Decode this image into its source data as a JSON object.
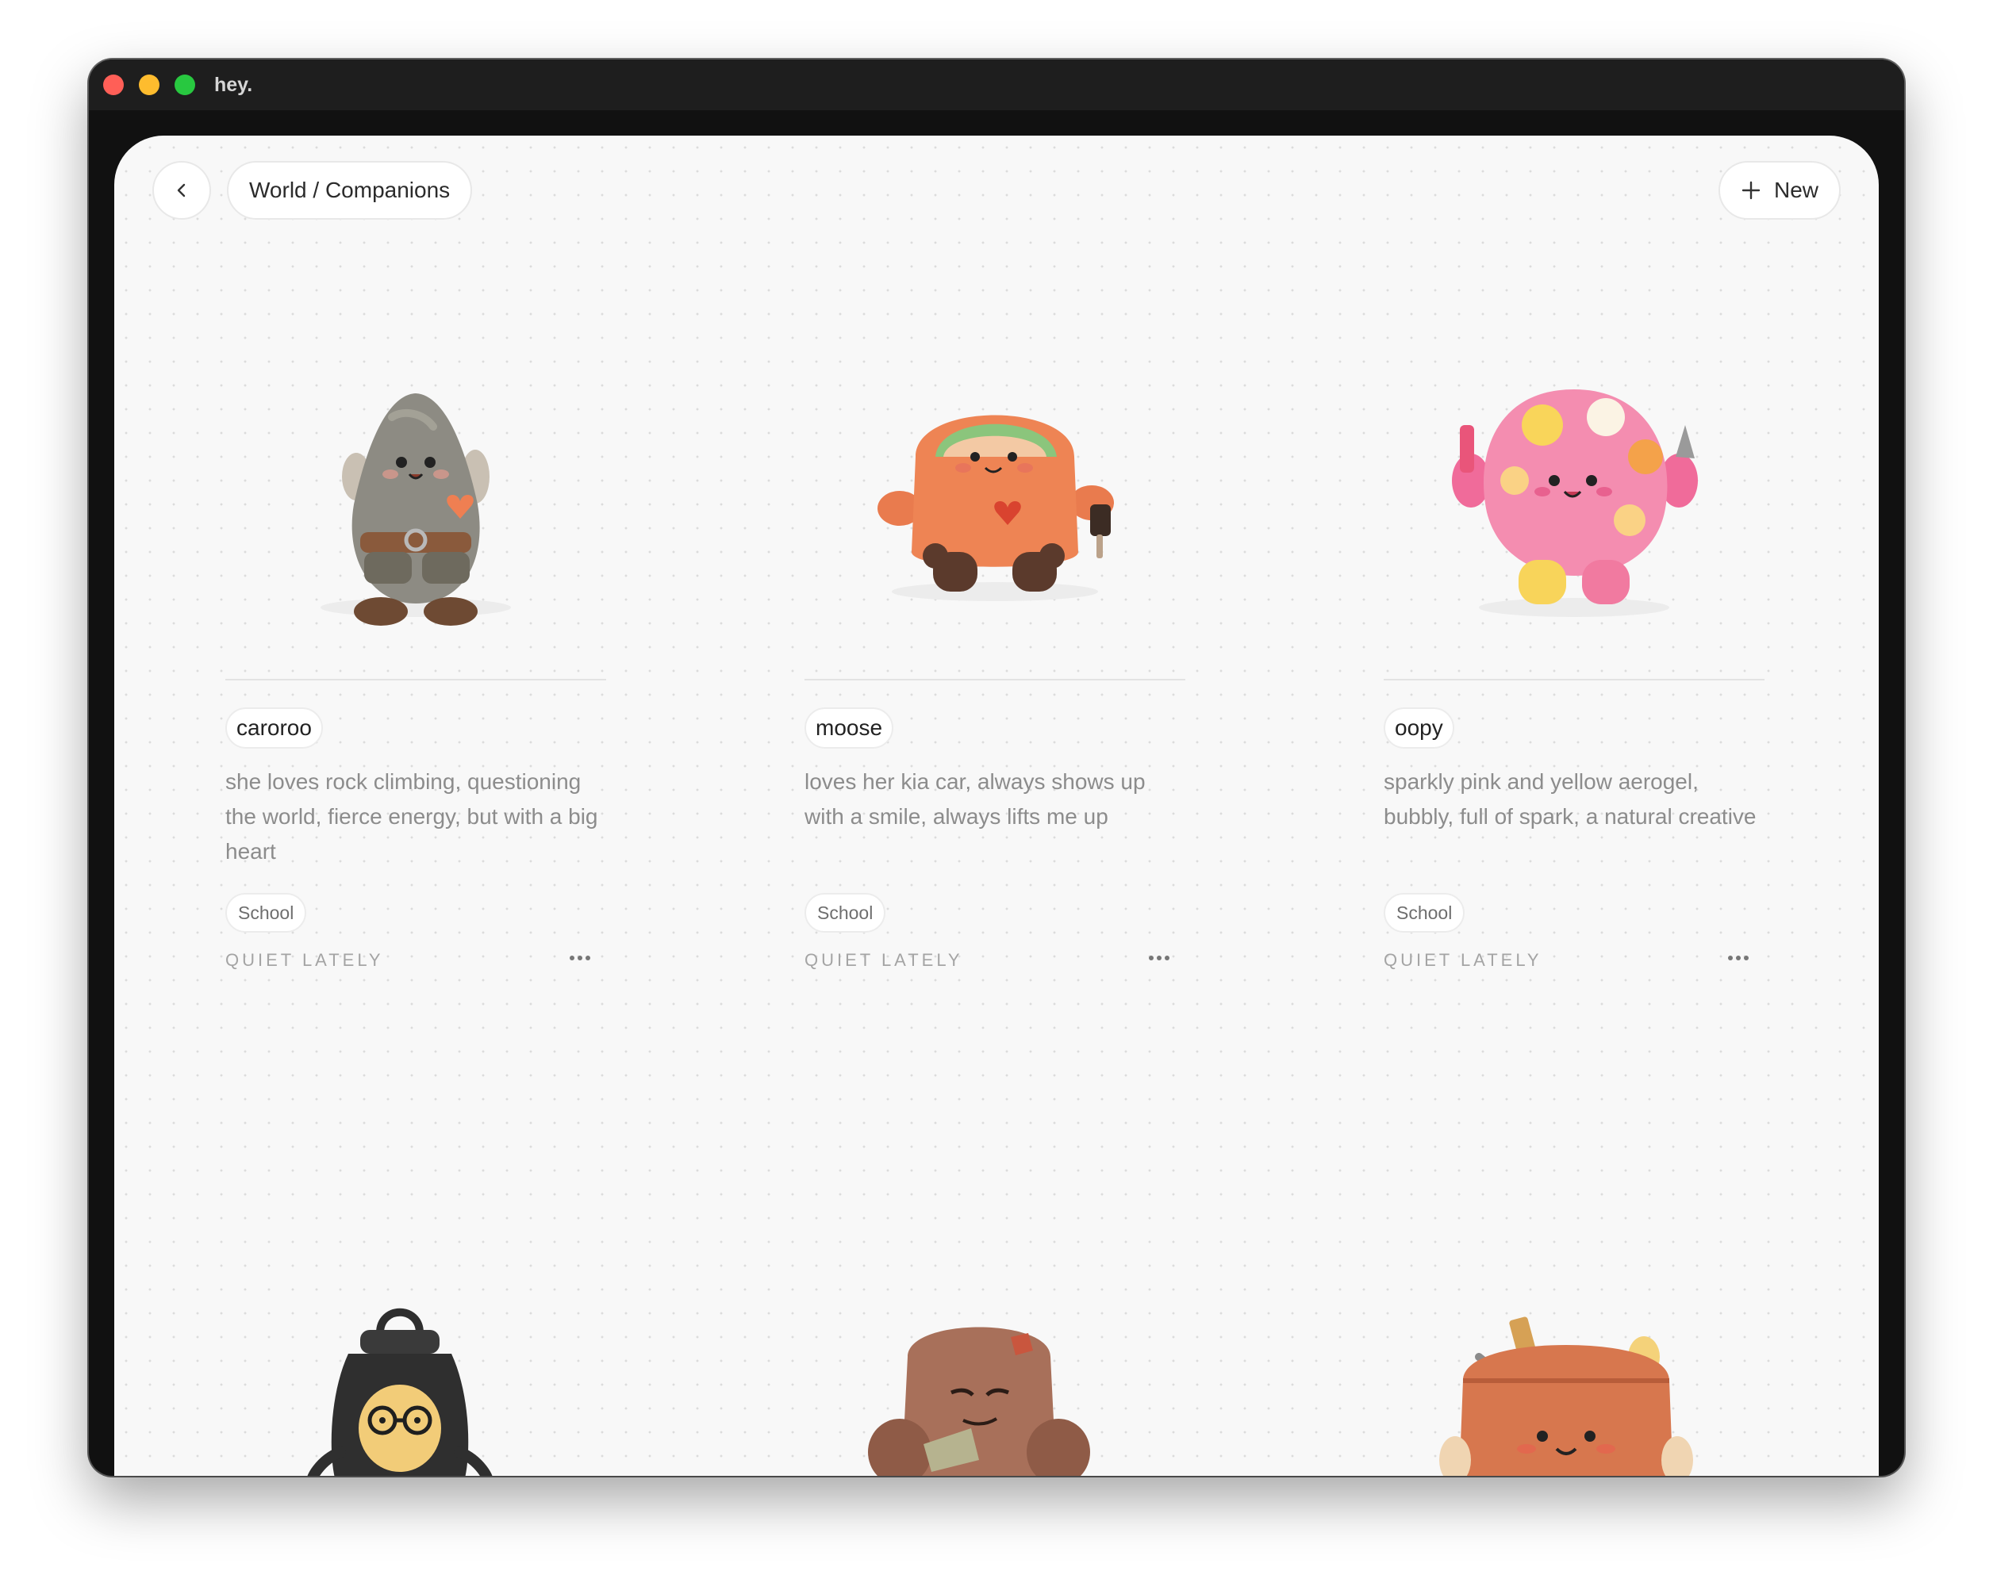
{
  "app": {
    "title": "hey."
  },
  "header": {
    "breadcrumb": "World / Companions",
    "new_label": "New"
  },
  "companions": [
    {
      "name": "caroroo",
      "description": "she loves rock climbing, questioning the world, fierce energy, but with a big heart",
      "tag": "School",
      "status": "QUIET LATELY"
    },
    {
      "name": "moose",
      "description": "loves her kia car, always shows up with a smile, always lifts me up",
      "tag": "School",
      "status": "QUIET LATELY"
    },
    {
      "name": "oopy",
      "description": "sparkly pink and yellow aerogel, bubbly, full of spark, a natural creative",
      "tag": "School",
      "status": "QUIET LATELY"
    }
  ],
  "colors": {
    "accent_red": "#ff5f57",
    "accent_yellow": "#febc2e",
    "accent_green": "#28c840",
    "background": "#f8f8f8"
  },
  "icons": {
    "back": "chevron-left-icon",
    "new": "plus-icon",
    "more": "ellipsis-icon"
  }
}
